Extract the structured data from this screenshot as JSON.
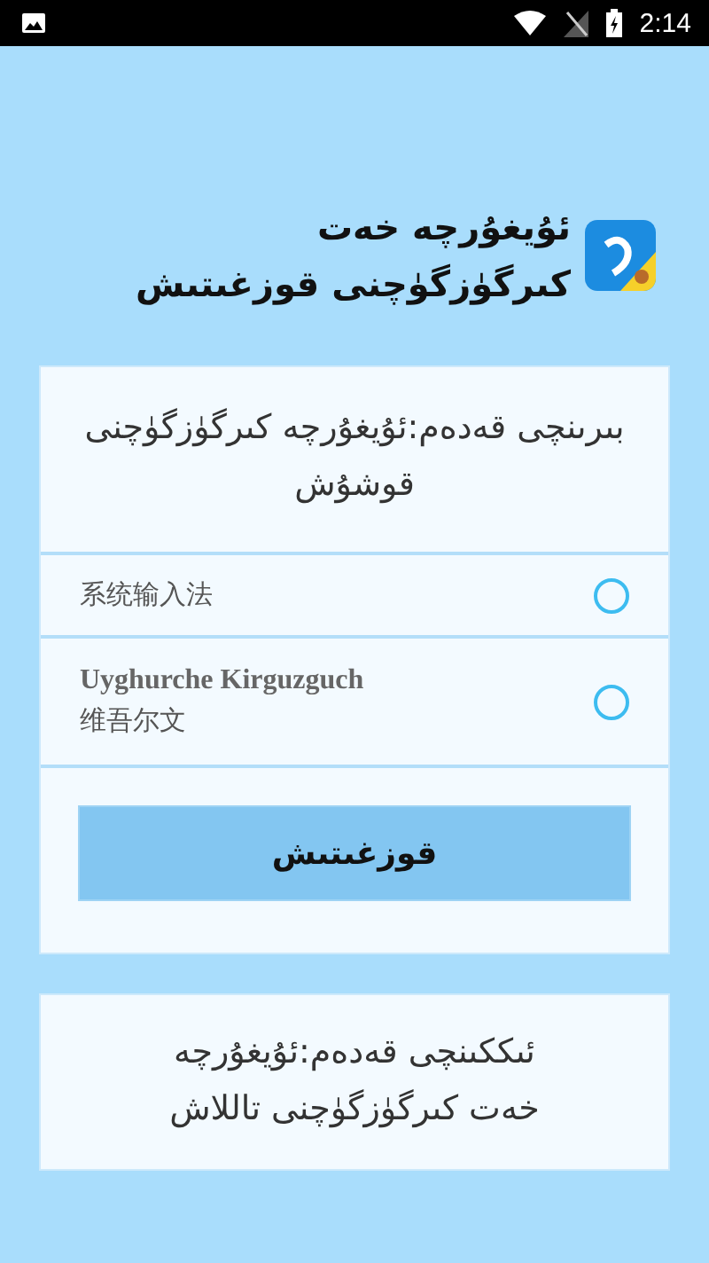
{
  "status_bar": {
    "time": "2:14"
  },
  "header": {
    "title": "ئۇيغۇرچە خەت كىرگۈزگۈچنى قوزغىتىش"
  },
  "step_one": {
    "title": "بىرىنچى قەدەم:ئۇيغۇرچە كىرگۈزگۈچنى قوشۇش",
    "options": [
      {
        "label": "系统输入法",
        "selected": false
      },
      {
        "label": "Uyghurche Kirguzguch",
        "sublabel": "维吾尔文",
        "selected": false
      }
    ],
    "button": "قوزغىتىش"
  },
  "step_two": {
    "title": "ئىككىنچى قەدەم:ئۇيغۇرچە خەت كىرگۈزگۈچنى تاللاش"
  }
}
